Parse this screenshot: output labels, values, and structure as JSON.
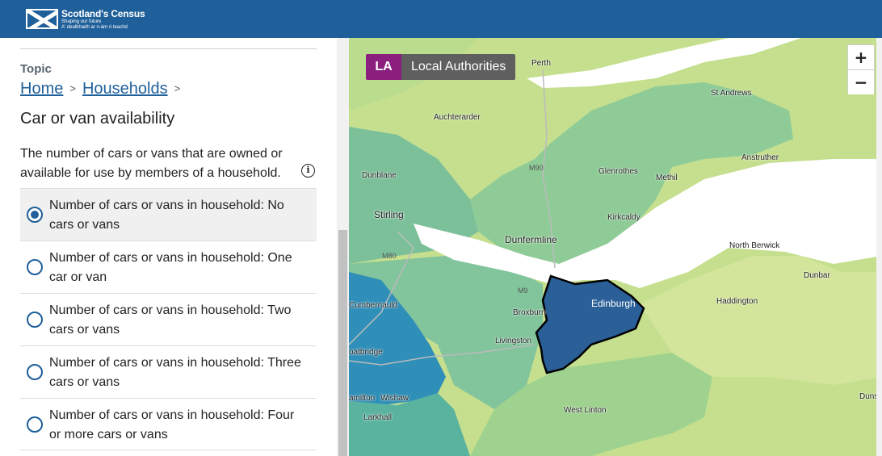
{
  "header": {
    "brand": "Scotland's Census",
    "tagline_en": "Shaping our future",
    "tagline_gd": "A' dealbhadh ar n-àm ri teachd"
  },
  "sidebar": {
    "topic_label": "Topic",
    "breadcrumb": {
      "home": "Home",
      "sep1": ">",
      "section": "Households",
      "sep2": ">"
    },
    "title": "Car or van availability",
    "description": "The number of cars or vans that are owned or available for use by members of a household.",
    "info_icon_glyph": "i",
    "options": [
      {
        "label": "Number of cars or vans in household: No cars or vans",
        "selected": true
      },
      {
        "label": "Number of cars or vans in household: One car or van",
        "selected": false
      },
      {
        "label": "Number of cars or vans in household: Two cars or vans",
        "selected": false
      },
      {
        "label": "Number of cars or vans in household: Three cars or vans",
        "selected": false
      },
      {
        "label": "Number of cars or vans in household: Four or more cars or vans",
        "selected": false
      }
    ]
  },
  "map": {
    "badge_code": "LA",
    "badge_label": "Local Authorities",
    "zoom_in": "+",
    "zoom_out": "−",
    "places": {
      "perth": "Perth",
      "st_andrews": "St Andrews",
      "auchterarder": "Auchterarder",
      "anstruther": "Anstruther",
      "dunblane": "Dunblane",
      "glenrothes": "Glenrothes",
      "methil": "Methil",
      "stirling": "Stirling",
      "kirkcaldy": "Kirkcaldy",
      "dunfermline": "Dunfermline",
      "north_berwick": "North Berwick",
      "dunbar": "Dunbar",
      "cumbernauld": "Cumbernauld",
      "edinburgh": "Edinburgh",
      "broxburn": "Broxburn",
      "haddington": "Haddington",
      "livingston": "Livingston",
      "coatbridge": "oatbridge",
      "hamilton": "amilton",
      "wishaw": "Wishaw",
      "west_linton": "West Linton",
      "duns": "Duns",
      "larkhall": "Larkhall"
    },
    "roads": {
      "m90": "M90",
      "m80": "M80",
      "m9": "M9"
    },
    "colors": {
      "accent": "#1f5f9a",
      "badge": "#8a1f7e",
      "selected_la": "#2a5f97"
    }
  }
}
